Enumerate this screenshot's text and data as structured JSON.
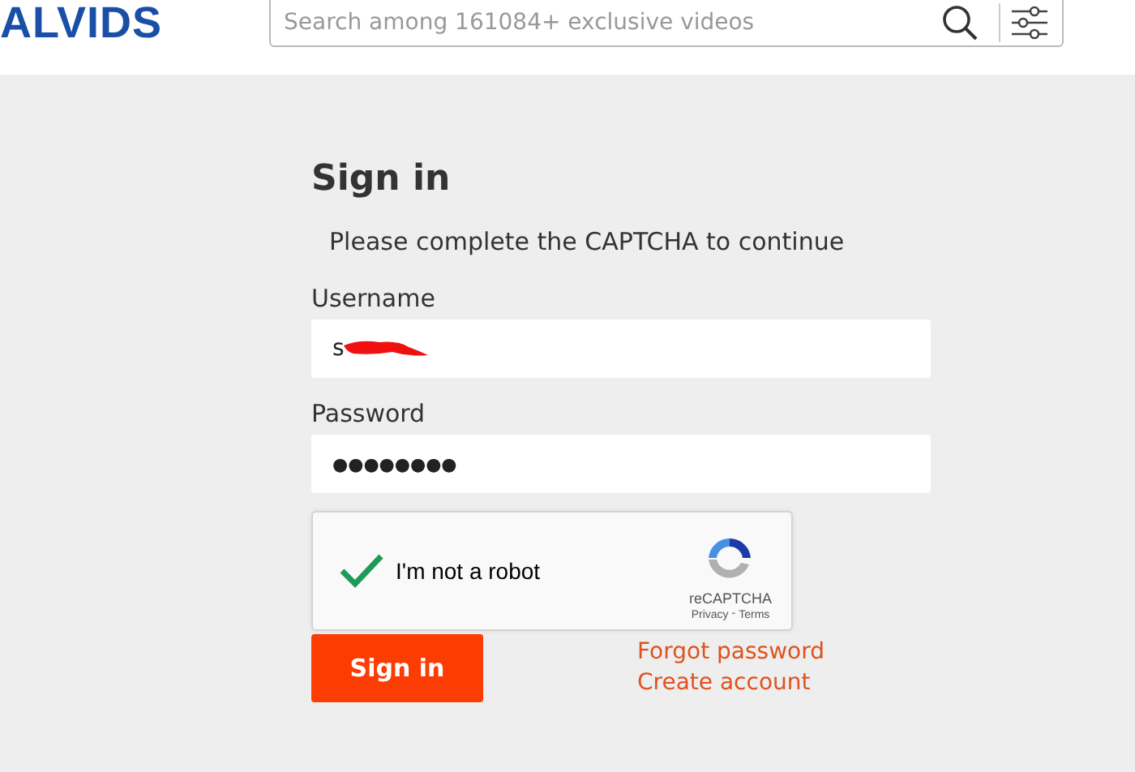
{
  "header": {
    "logo": "ALVIDS",
    "search": {
      "placeholder": "Search among 161084+ exclusive videos"
    }
  },
  "form": {
    "title": "Sign in",
    "message": "Please complete the CAPTCHA to continue",
    "fields": [
      {
        "label": "Username",
        "value": "s",
        "redacted": true
      },
      {
        "label": "Password",
        "value": "●●●●●●●●",
        "redacted": false
      }
    ],
    "captcha": {
      "checked": true,
      "label": "I'm not a robot",
      "brand": "reCAPTCHA",
      "privacy": "Privacy",
      "separator": "-",
      "terms": "Terms"
    },
    "submit": "Sign in",
    "links": [
      "Forgot password",
      "Create account"
    ]
  }
}
